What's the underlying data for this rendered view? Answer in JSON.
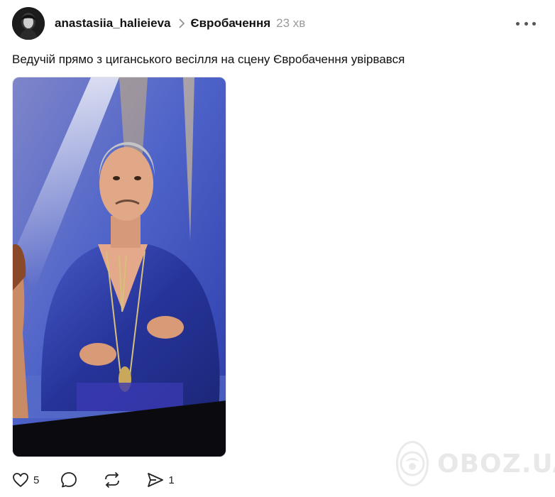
{
  "post": {
    "author": "anastasiia_halieieva",
    "topic": "Євробачення",
    "time": "23 хв",
    "text": "Ведучій прямо з циганського весілля на сцену Євробачення увірвався"
  },
  "actions": {
    "likes": "5",
    "comments": "",
    "reposts": "",
    "shares": "1"
  },
  "watermark": {
    "brand": "OBOZ.UA"
  },
  "icons": {
    "more": "more-dots-icon",
    "chevron": "chevron-right-icon",
    "like": "heart-icon",
    "comment": "comment-icon",
    "repost": "repost-icon",
    "share": "share-icon",
    "watermark": "oboz-logo-icon"
  },
  "colors": {
    "muted": "#9a9a9a",
    "shirt": "#2f3f9e",
    "stage": "#6b8bd8"
  }
}
